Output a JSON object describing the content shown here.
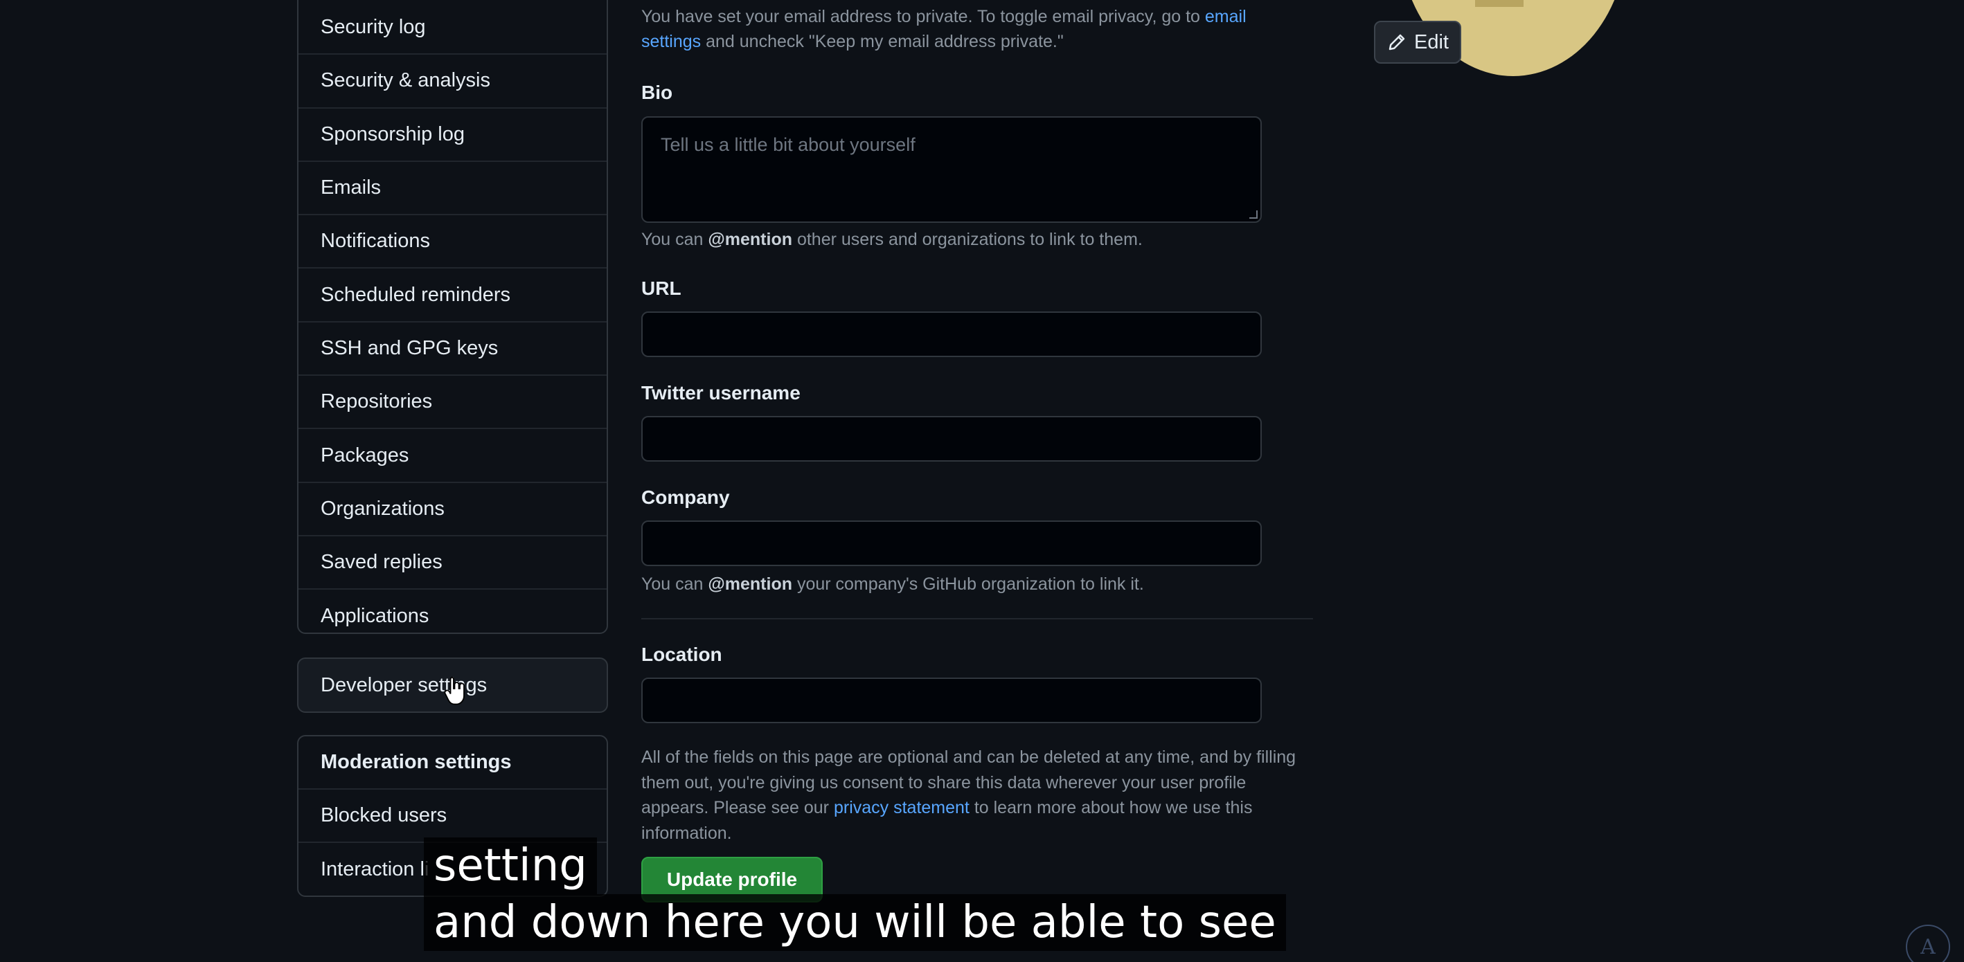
{
  "sidebar": {
    "items": [
      {
        "label": "Security log"
      },
      {
        "label": "Security & analysis"
      },
      {
        "label": "Sponsorship log"
      },
      {
        "label": "Emails"
      },
      {
        "label": "Notifications"
      },
      {
        "label": "Scheduled reminders"
      },
      {
        "label": "SSH and GPG keys"
      },
      {
        "label": "Repositories"
      },
      {
        "label": "Packages"
      },
      {
        "label": "Organizations"
      },
      {
        "label": "Saved replies"
      },
      {
        "label": "Applications"
      }
    ],
    "developer_settings": "Developer settings",
    "moderation": {
      "header": "Moderation settings",
      "items": [
        {
          "label": "Blocked users"
        },
        {
          "label": "Interaction li"
        }
      ]
    }
  },
  "form": {
    "email_note_prefix": "You have set your email address to private. To toggle email privacy, go to ",
    "email_note_link": "email settings",
    "email_note_suffix": " and uncheck \"Keep my email address private.\"",
    "bio": {
      "label": "Bio",
      "placeholder": "Tell us a little bit about yourself",
      "hint_prefix": "You can ",
      "hint_bold": "@mention",
      "hint_suffix": " other users and organizations to link to them."
    },
    "url": {
      "label": "URL",
      "value": ""
    },
    "twitter": {
      "label": "Twitter username",
      "value": ""
    },
    "company": {
      "label": "Company",
      "value": "",
      "hint_prefix": "You can ",
      "hint_bold": "@mention",
      "hint_suffix": " your company's GitHub organization to link it."
    },
    "location": {
      "label": "Location",
      "value": ""
    },
    "disclaimer_prefix": "All of the fields on this page are optional and can be deleted at any time, and by filling them out, you're giving us consent to share this data wherever your user profile appears. Please see our ",
    "disclaimer_link": "privacy statement",
    "disclaimer_suffix": " to learn more about how we use this information.",
    "update_button": "Update profile"
  },
  "avatar": {
    "edit_label": "Edit",
    "edit_icon": "pencil-icon"
  },
  "captions": {
    "line1": "setting",
    "line2": "and down here you will be able to see"
  },
  "watermark": {
    "letter": "A"
  },
  "colors": {
    "background": "#0d1117",
    "link": "#58a6ff",
    "primary_button": "#238636",
    "avatar": "#d8c684"
  }
}
